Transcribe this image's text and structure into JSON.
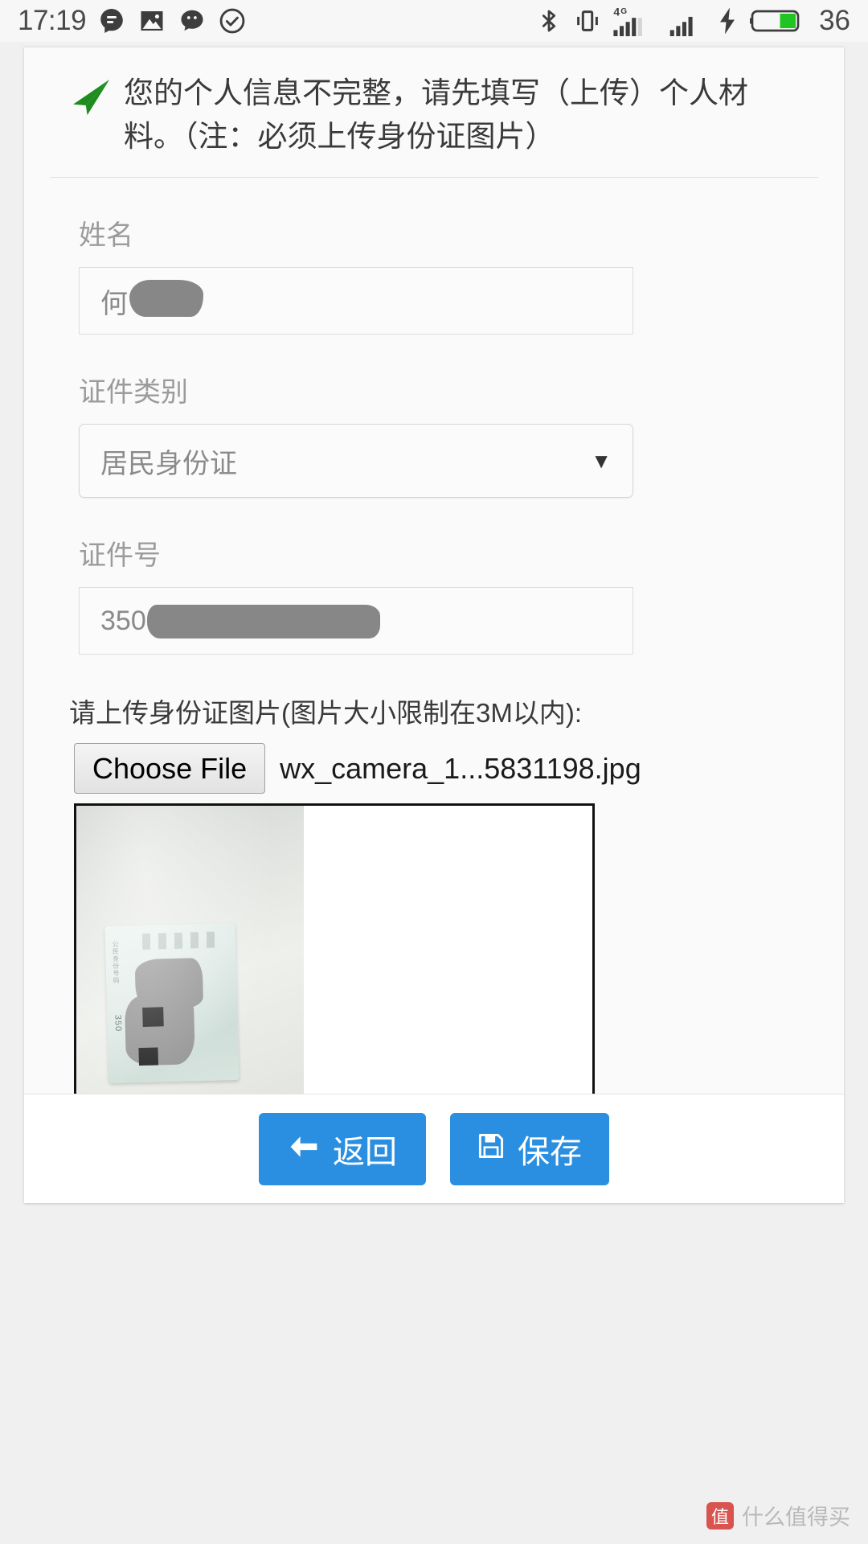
{
  "statusbar": {
    "time": "17:19",
    "left_icons": [
      "messaging-icon",
      "gallery-icon",
      "wechat-icon",
      "check-circle-icon"
    ],
    "right_icons": [
      "bluetooth-icon",
      "vibrate-icon",
      "signal-4g-icon",
      "signal-icon",
      "charging-bolt-icon",
      "battery-icon"
    ],
    "network_label": "4G",
    "battery_level": "36"
  },
  "alert": {
    "icon": "paper-plane-icon",
    "icon_color": "#1e8c1e",
    "message": "您的个人信息不完整，请先填写（上传）个人材料。（注：必须上传身份证图片）"
  },
  "form": {
    "name": {
      "label": "姓名",
      "value": "何",
      "redacted": true
    },
    "id_type": {
      "label": "证件类别",
      "value": "居民身份证",
      "caret": "▼"
    },
    "id_number": {
      "label": "证件号",
      "value": "350",
      "redacted": true
    }
  },
  "upload": {
    "label": "请上传身份证图片(图片大小限制在3M以内):",
    "choose_button": "Choose File",
    "file_name": "wx_camera_1...5831198.jpg",
    "preview_alt": "id-card-photo"
  },
  "footer": {
    "back": {
      "label": "返回",
      "icon": "arrow-left-icon"
    },
    "save": {
      "label": "保存",
      "icon": "floppy-disk-icon"
    },
    "accent_color": "#2a8fe0"
  },
  "watermark": {
    "badge": "值",
    "text": "什么值得买"
  }
}
